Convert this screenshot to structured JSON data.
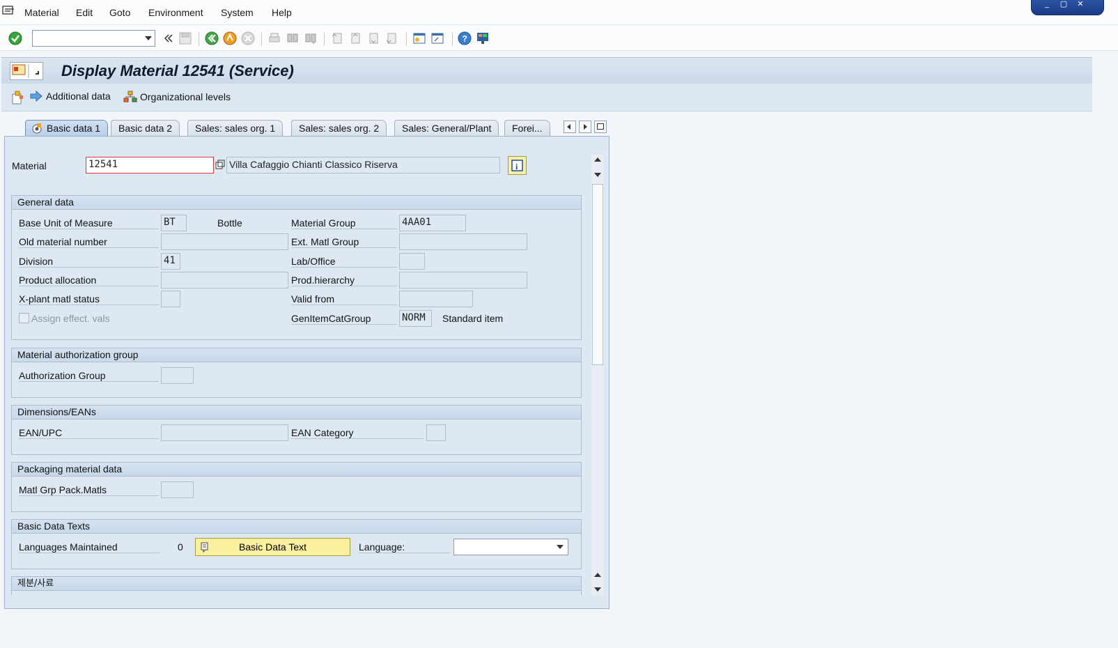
{
  "menu": {
    "items": [
      "Material",
      "Edit",
      "Goto",
      "Environment",
      "System",
      "Help"
    ]
  },
  "toolbar": {
    "command_field_value": ""
  },
  "title": {
    "text": "Display Material 12541 (Service)"
  },
  "app_toolbar": {
    "additional_data": "Additional data",
    "org_levels": "Organizational levels"
  },
  "tabs": [
    "Basic data 1",
    "Basic data 2",
    "Sales: sales org. 1",
    "Sales: sales org. 2",
    "Sales: General/Plant",
    "Forei..."
  ],
  "header": {
    "material_label": "Material",
    "material_value": "12541",
    "description": "Villa Cafaggio Chianti Classico Riserva"
  },
  "general": {
    "title": "General data",
    "base_uom_label": "Base Unit of Measure",
    "base_uom_value": "BT",
    "base_uom_text": "Bottle",
    "material_group_label": "Material Group",
    "material_group_value": "4AA01",
    "old_matnr_label": "Old material number",
    "old_matnr_value": "",
    "ext_matl_group_label": "Ext. Matl Group",
    "ext_matl_group_value": "",
    "division_label": "Division",
    "division_value": "41",
    "lab_office_label": "Lab/Office",
    "lab_office_value": "",
    "product_alloc_label": "Product allocation",
    "product_alloc_value": "",
    "prod_hierarchy_label": "Prod.hierarchy",
    "prod_hierarchy_value": "",
    "xplant_status_label": "X-plant matl status",
    "xplant_status_value": "",
    "valid_from_label": "Valid from",
    "valid_from_value": "",
    "assign_effect_label": "Assign effect. vals",
    "gen_item_cat_label": "GenItemCatGroup",
    "gen_item_cat_value": "NORM",
    "gen_item_cat_text": "Standard item"
  },
  "auth": {
    "title": "Material authorization group",
    "auth_group_label": "Authorization Group",
    "auth_group_value": ""
  },
  "dimensions": {
    "title": "Dimensions/EANs",
    "ean_label": "EAN/UPC",
    "ean_value": "",
    "ean_cat_label": "EAN Category",
    "ean_cat_value": ""
  },
  "packaging": {
    "title": "Packaging material data",
    "matl_grp_pack_label": "Matl Grp Pack.Matls",
    "matl_grp_pack_value": ""
  },
  "texts": {
    "title": "Basic Data Texts",
    "languages_label": "Languages Maintained",
    "languages_count": "0",
    "basic_data_text_button": "Basic Data Text",
    "language_label": "Language:",
    "language_value": ""
  },
  "next_group": {
    "title": "제분/사료"
  },
  "colors": {
    "panel_bg": "#dde8f3",
    "title_bar": "#cbd9e8",
    "highlight_button": "#fbf0a0"
  }
}
